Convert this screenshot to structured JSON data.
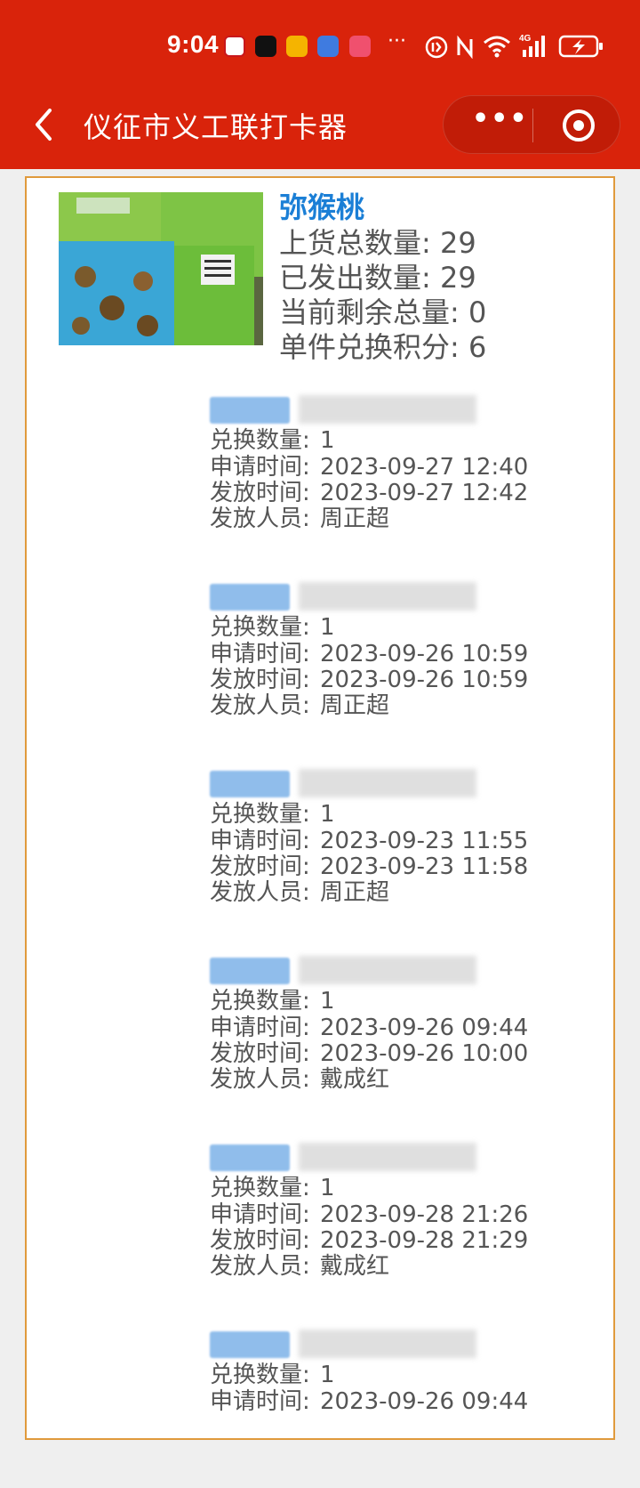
{
  "status_bar": {
    "time": "9:04",
    "overflow": "···"
  },
  "nav": {
    "title": "仪征市义工联打卡器"
  },
  "product": {
    "name": "弥猴桃",
    "total_label": "上货总数量:",
    "total": "29",
    "shipped_label": "已发出数量:",
    "shipped": "29",
    "remaining_label": "当前剩余总量:",
    "remaining": "0",
    "points_label": "单件兑换积分:",
    "points": "6"
  },
  "labels": {
    "qty": "兑换数量:",
    "apply": "申请时间:",
    "issue": "发放时间:",
    "staff": "发放人员:"
  },
  "records": [
    {
      "qty": "1",
      "apply": "2023-09-27 12:40",
      "issue": "2023-09-27 12:42",
      "staff": "周正超"
    },
    {
      "qty": "1",
      "apply": "2023-09-26 10:59",
      "issue": "2023-09-26 10:59",
      "staff": "周正超"
    },
    {
      "qty": "1",
      "apply": "2023-09-23 11:55",
      "issue": "2023-09-23 11:58",
      "staff": "周正超"
    },
    {
      "qty": "1",
      "apply": "2023-09-26 09:44",
      "issue": "2023-09-26 10:00",
      "staff": "戴成红"
    },
    {
      "qty": "1",
      "apply": "2023-09-28 21:26",
      "issue": "2023-09-28 21:29",
      "staff": "戴成红"
    },
    {
      "qty": "1",
      "apply": "2023-09-26 09:44"
    }
  ]
}
